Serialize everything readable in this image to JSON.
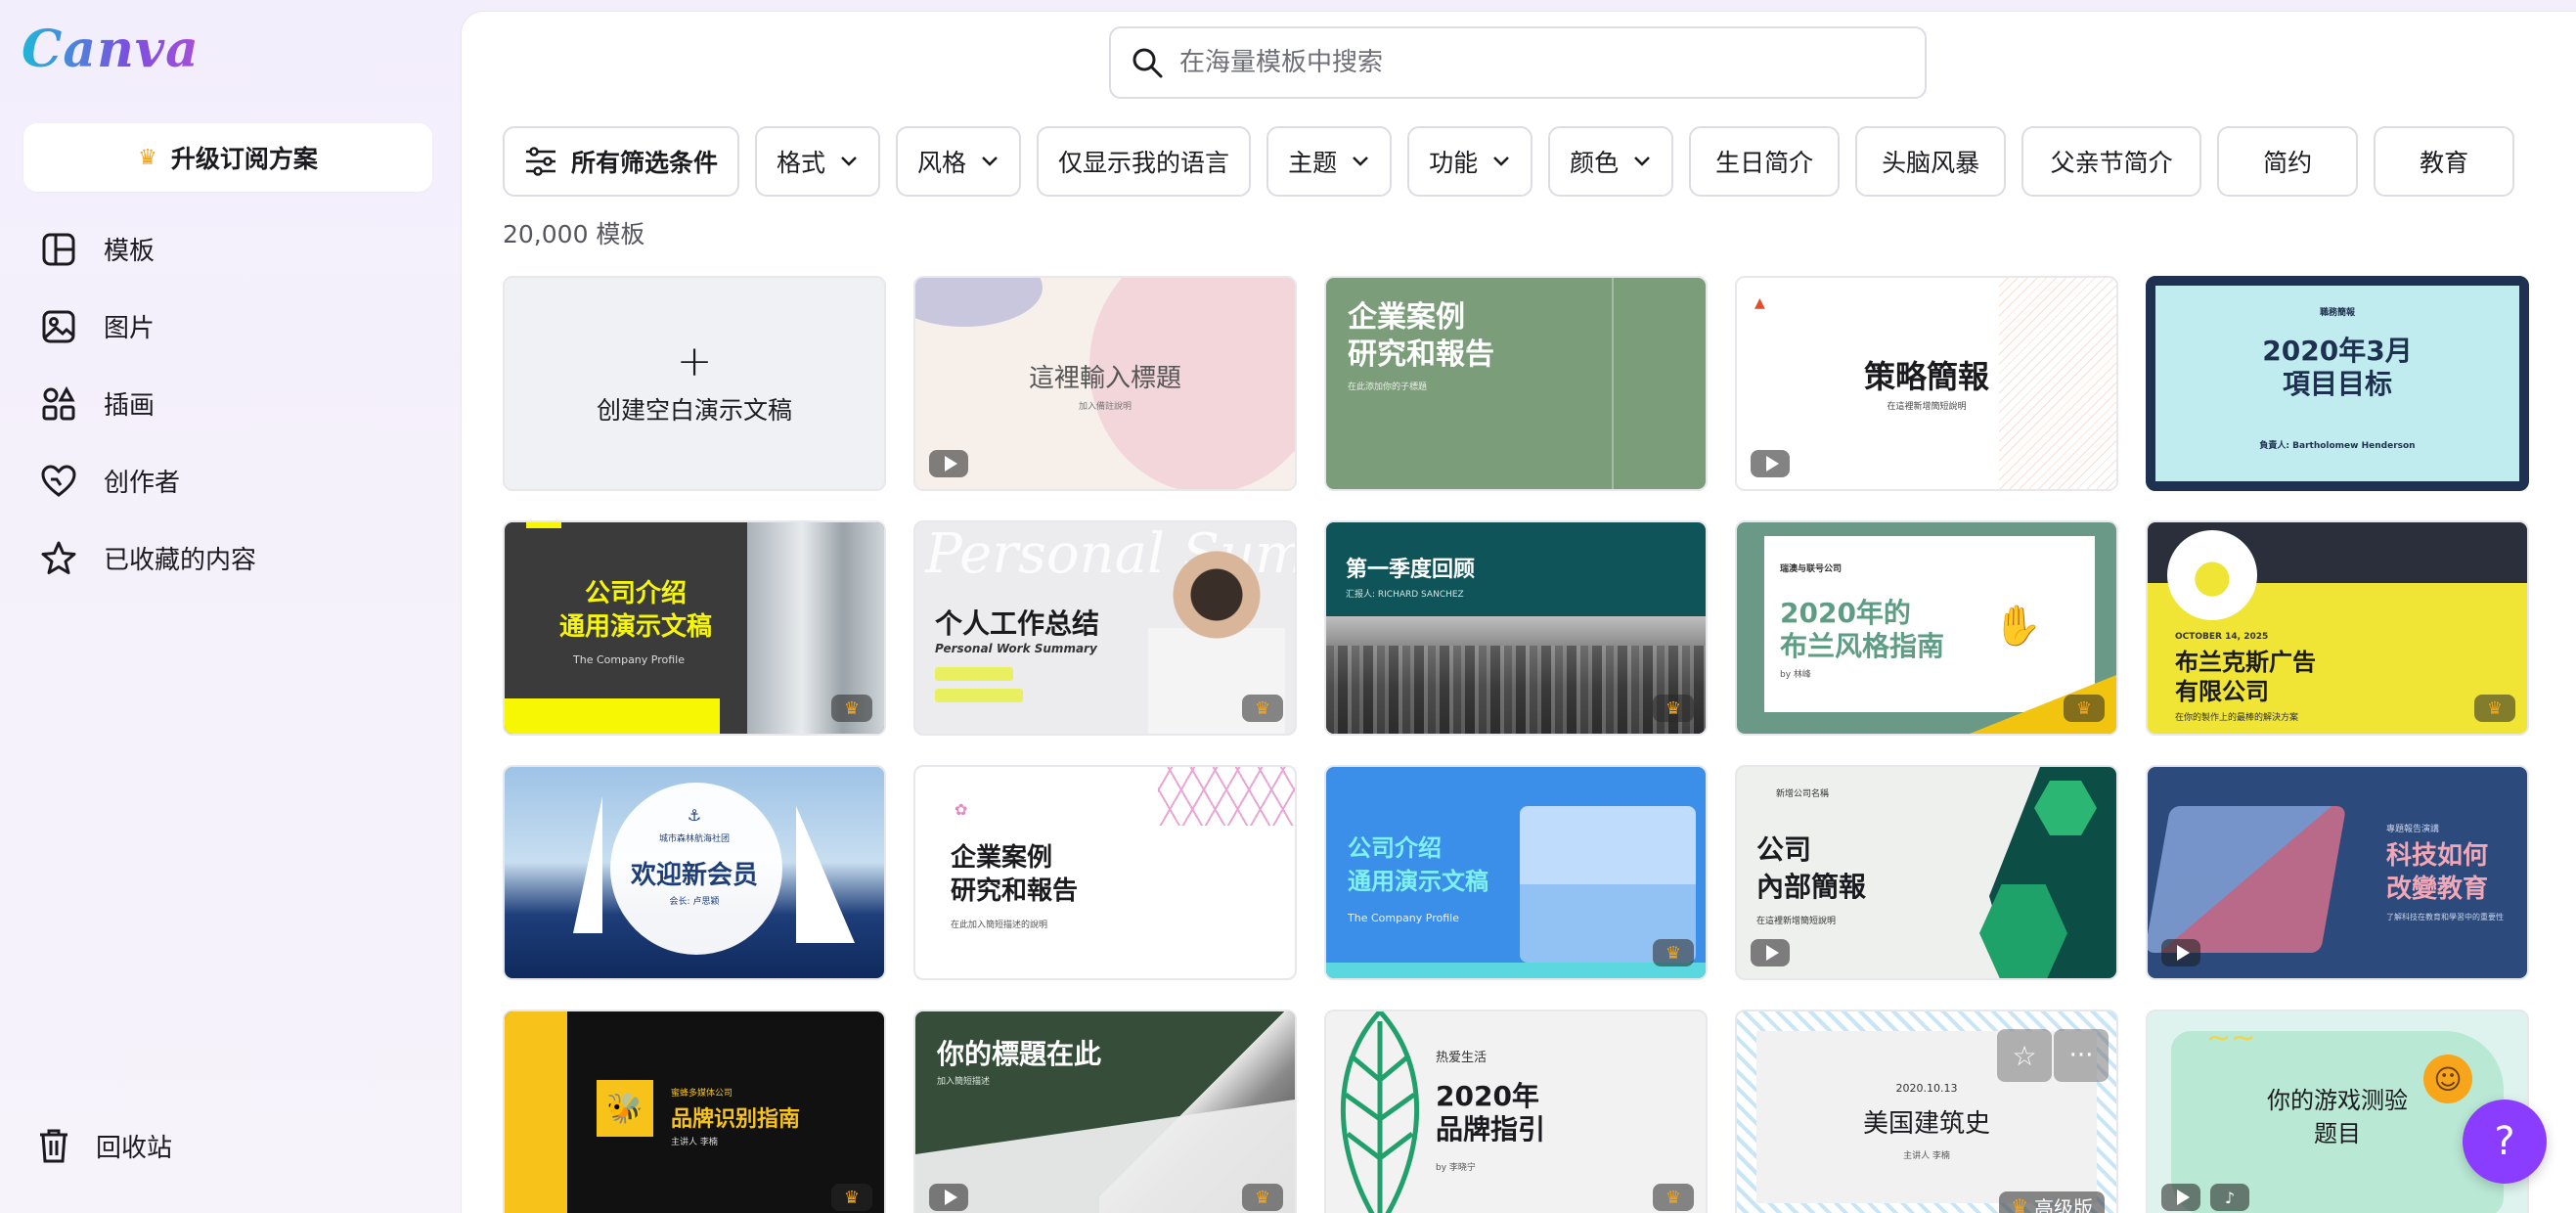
{
  "brand": {
    "logo_text": "Canva"
  },
  "sidebar": {
    "upgrade_label": "升级订阅方案",
    "items": [
      {
        "label": "模板",
        "icon": "template-icon"
      },
      {
        "label": "图片",
        "icon": "image-icon"
      },
      {
        "label": "插画",
        "icon": "illustration-icon"
      },
      {
        "label": "创作者",
        "icon": "creator-icon"
      },
      {
        "label": "已收藏的内容",
        "icon": "star-icon"
      }
    ],
    "trash_label": "回收站"
  },
  "search": {
    "placeholder": "在海量模板中搜索"
  },
  "filters": [
    {
      "label": "所有筛选条件",
      "icon": "filter-icon"
    },
    {
      "label": "格式",
      "dropdown": true
    },
    {
      "label": "风格",
      "dropdown": true
    },
    {
      "label": "仅显示我的语言"
    },
    {
      "label": "主题",
      "dropdown": true
    },
    {
      "label": "功能",
      "dropdown": true
    },
    {
      "label": "颜色",
      "dropdown": true
    },
    {
      "label": "生日简介"
    },
    {
      "label": "头脑风暴"
    },
    {
      "label": "父亲节简介"
    },
    {
      "label": "简约"
    },
    {
      "label": "教育"
    }
  ],
  "result_count": "20,000 模板",
  "create_blank": {
    "plus": "+",
    "label": "创建空白演示文稿"
  },
  "templates": [
    {
      "title": "這裡輸入標題",
      "subtitle": "加入備註說明"
    },
    {
      "title": "企業案例\n研究和報告",
      "subtitle": "在此添加你的子標題"
    },
    {
      "title": "策略簡報",
      "subtitle": "在這裡新增簡短說明"
    },
    {
      "title": "2020年3月\n項目目标",
      "subtitle": "負責人: Bartholomew Henderson",
      "kicker": "職務簡報"
    },
    {
      "title": "公司介绍\n通用演示文稿",
      "subtitle": "The Company Profile"
    },
    {
      "title": "个人工作总结",
      "subtitle": "Personal Work Summary",
      "bg_text": "Personal Summary"
    },
    {
      "title": "第一季度回顾",
      "subtitle": "汇报人: RICHARD SANCHEZ"
    },
    {
      "title": "2020年的\n布兰风格指南",
      "subtitle": "by 林峰",
      "kicker": "瑞澳与联号公司"
    },
    {
      "title": "布兰克斯广告\n有限公司",
      "subtitle": "在你的製作上的最棒的解決方案",
      "kicker": "OCTOBER 14, 2025"
    },
    {
      "title": "欢迎新会员",
      "subtitle": "会长: 卢思颖",
      "kicker": "城市森林航海社团"
    },
    {
      "title": "企業案例\n研究和報告",
      "subtitle": "在此加入簡短描述的說明"
    },
    {
      "title": "公司介绍\n通用演示文稿",
      "subtitle": "The Company Profile"
    },
    {
      "title": "公司\n內部簡報",
      "subtitle": "在這裡新增簡短說明",
      "kicker": "新增公司名稱"
    },
    {
      "title": "科技如何\n改變教育",
      "subtitle": "了解科技在教育和學習中的重要性",
      "kicker": "專題報告演講"
    },
    {
      "title": "品牌识别指南",
      "subtitle": "主讲人 李楠",
      "kicker": "蜜蜂多媒体公司"
    },
    {
      "title": "你的標題在此",
      "subtitle": "加入簡短描述"
    },
    {
      "title": "2020年\n品牌指引",
      "subtitle": "by 李晓宁",
      "kicker": "热爱生活"
    },
    {
      "title": "美国建筑史",
      "subtitle": "主讲人 李楠",
      "kicker": "2020.10.13",
      "badge": "高级版"
    },
    {
      "title": "你的游戏测验\n题目",
      "subtitle": ""
    }
  ],
  "colors": {
    "accent": "#8b3dff",
    "crown": "#f2a41b"
  },
  "help_label": "?"
}
